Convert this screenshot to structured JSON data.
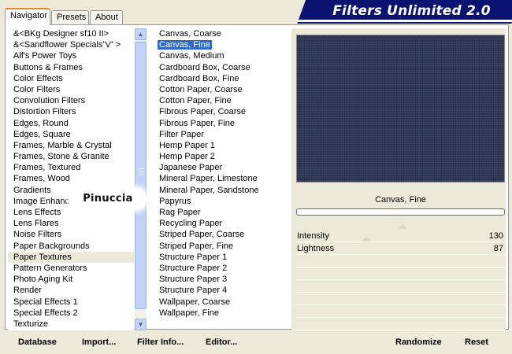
{
  "app": {
    "title": "Filters Unlimited 2.0",
    "colors": {
      "banner": "#0a1470",
      "selection": "#316ac5",
      "tab_accent": "#e68b2c",
      "preview": "#2f3857"
    }
  },
  "tabs": [
    {
      "label": "Navigator",
      "active": true
    },
    {
      "label": "Presets",
      "active": false
    },
    {
      "label": "About",
      "active": false
    }
  ],
  "categories": [
    "&<BKg Designer sf10 II>",
    "&<Sandflower Specials\"v\" >",
    "Alf's Power Toys",
    "Buttons & Frames",
    "Color Effects",
    "Color Filters",
    "Convolution Filters",
    "Distortion Filters",
    "Edges, Round",
    "Edges, Square",
    "Frames, Marble & Crystal",
    "Frames, Stone & Granite",
    "Frames, Textured",
    "Frames, Wood",
    "Gradients",
    "Image Enhancement",
    "Lens Effects",
    "Lens Flares",
    "Noise Filters",
    "Paper Backgrounds",
    "Paper Textures",
    "Pattern Generators",
    "Photo Aging Kit",
    "Render",
    "Special Effects 1",
    "Special Effects 2",
    "Texturize"
  ],
  "selected_category": "Paper Textures",
  "filters": [
    "Canvas, Coarse",
    "Canvas, Fine",
    "Canvas, Medium",
    "Cardboard Box, Coarse",
    "Cardboard Box, Fine",
    "Cotton Paper, Coarse",
    "Cotton Paper, Fine",
    "Fibrous Paper, Coarse",
    "Fibrous Paper, Fine",
    "Filter Paper",
    "Hemp Paper 1",
    "Hemp Paper 2",
    "Japanese Paper",
    "Mineral Paper, Limestone",
    "Mineral Paper, Sandstone",
    "Papyrus",
    "Rag Paper",
    "Recycling Paper",
    "Striped Paper, Coarse",
    "Striped Paper, Fine",
    "Structure Paper 1",
    "Structure Paper 2",
    "Structure Paper 3",
    "Structure Paper 4",
    "Wallpaper, Coarse",
    "Wallpaper, Fine"
  ],
  "selected_filter": "Canvas, Fine",
  "preview": {
    "filter_name": "Canvas, Fine"
  },
  "params": [
    {
      "label": "Intensity",
      "value": "130",
      "level": 0.51
    },
    {
      "label": "Lightness",
      "value": "87",
      "level": 0.34
    }
  ],
  "buttons": {
    "database": "Database",
    "import": "Import...",
    "filter_info": "Filter Info...",
    "editor": "Editor...",
    "randomize": "Randomize",
    "reset": "Reset"
  },
  "watermark": "Pinuccia"
}
